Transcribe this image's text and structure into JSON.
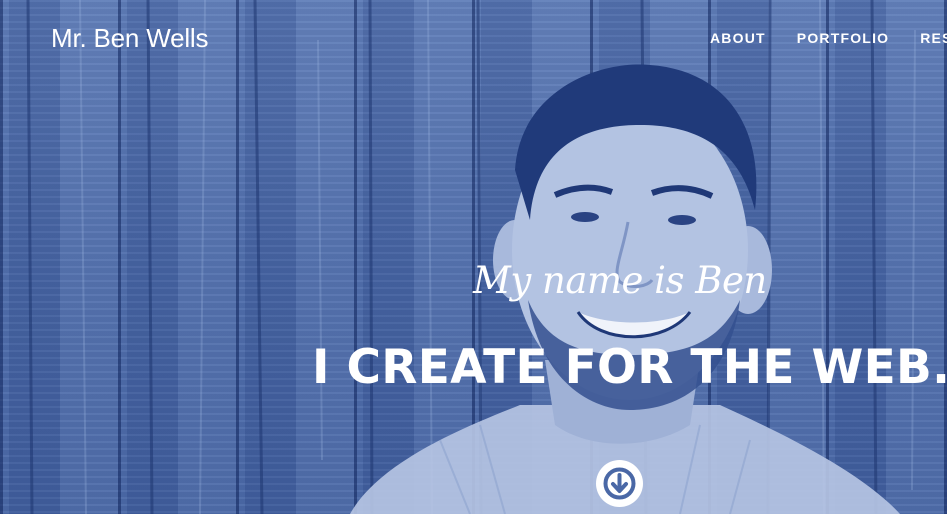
{
  "header": {
    "logo": "Mr. Ben Wells",
    "nav": [
      "ABOUT",
      "PORTFOLIO",
      "RES"
    ]
  },
  "hero": {
    "intro": "My name is Ben",
    "headline": "I CREATE FOR THE WEB.",
    "scroll_icon": "arrow-down-circle-icon"
  },
  "colors": {
    "tint": "#4a68a6",
    "text": "#ffffff"
  }
}
